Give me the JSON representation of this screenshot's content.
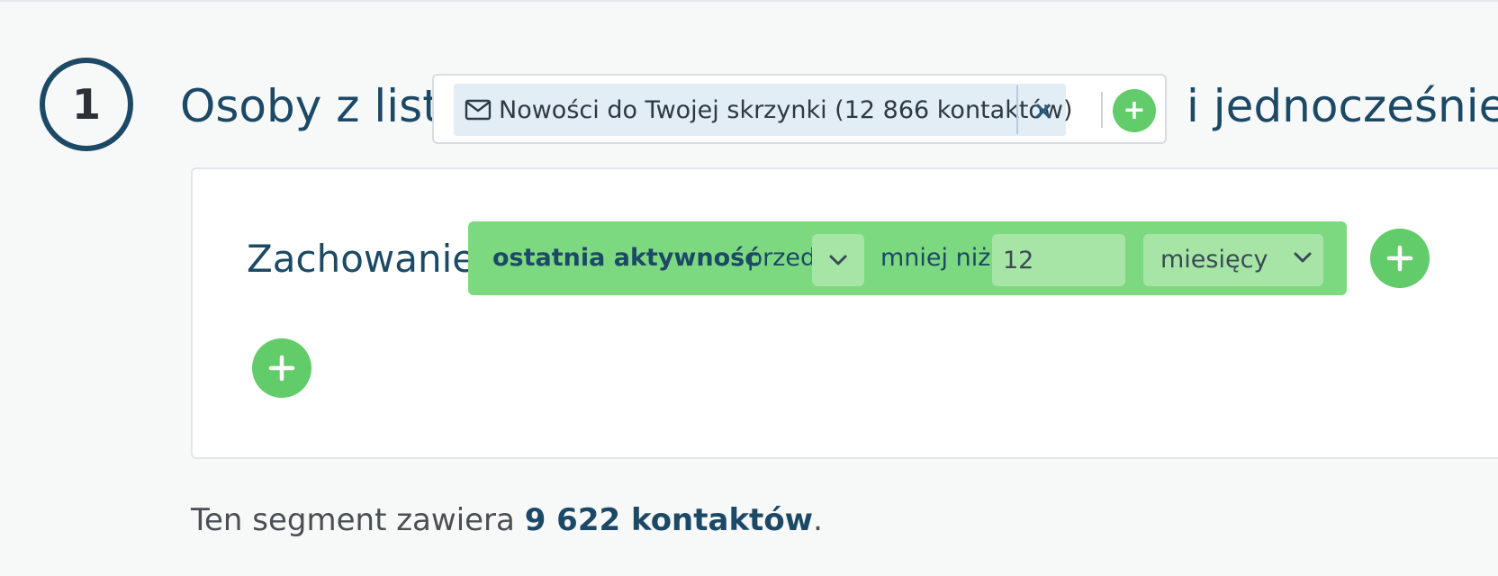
{
  "step": {
    "number": "1"
  },
  "header": {
    "prefix": "Osoby z list",
    "suffix": "i jednocześnie"
  },
  "list_selector": {
    "tags": [
      {
        "icon": "envelope-icon",
        "label": "Nowości do Twojej skrzynki (12 866 kontaktów)",
        "remove_label": "×"
      }
    ],
    "add_label": "+"
  },
  "conditions": {
    "label": "Zachowanie",
    "items": [
      {
        "name": "ostatnia aktywność",
        "operator": "przed",
        "comparison": "mniej niż",
        "value": "12",
        "unit": "miesięcy"
      }
    ],
    "add_condition_label": "+",
    "add_group_label": "+"
  },
  "summary": {
    "text_before": "Ten segment zawiera ",
    "count": "9 622 kontaktów",
    "text_after": "."
  },
  "colors": {
    "primary": "#1c4966",
    "accent_green": "#62cc6b",
    "condition_bg": "#7dd97f",
    "tag_bg": "#e3edf6"
  }
}
